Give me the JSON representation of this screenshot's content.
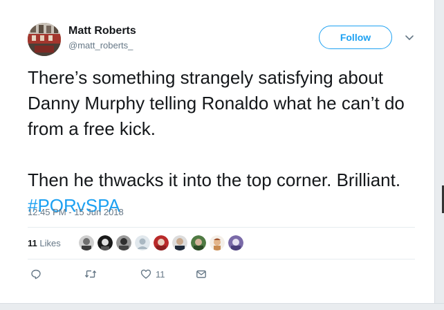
{
  "user": {
    "name": "Matt Roberts",
    "handle": "@matt_roberts_"
  },
  "follow_label": "Follow",
  "tweet": {
    "paragraph1": "There’s something strangely satisfying about Danny Murphy telling Ronaldo what he can’t do from a free kick.",
    "paragraph2_text": "Then he thwacks it into the top corner. Brilliant. ",
    "hashtag": "#PORvSPA"
  },
  "timestamp": "12:45 PM - 15 Jun 2018",
  "likes": {
    "count": "11",
    "label": "Likes"
  },
  "actions": {
    "like_count": "11"
  },
  "colors": {
    "accent": "#1da1f2",
    "secondary_text": "#657786",
    "primary_text": "#14171a",
    "divider": "#e6ecf0"
  },
  "icons": {
    "reply": "reply-icon",
    "retweet": "retweet-icon",
    "like": "heart-icon",
    "message": "envelope-icon",
    "caret": "chevron-down-icon"
  }
}
